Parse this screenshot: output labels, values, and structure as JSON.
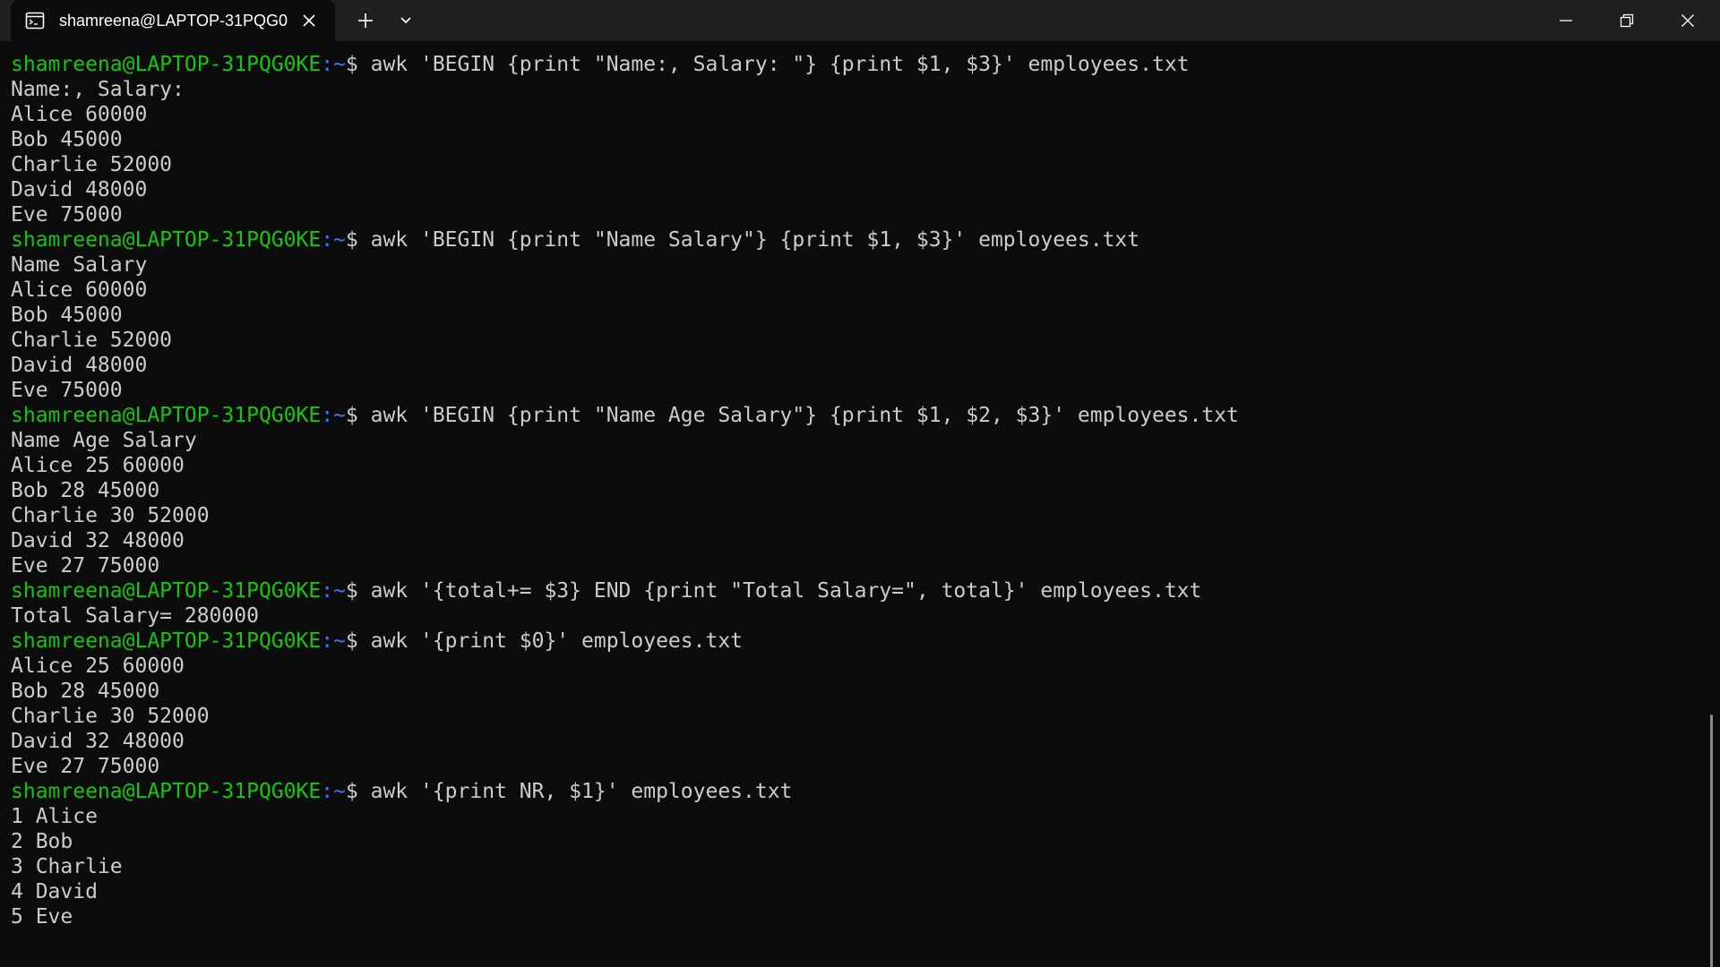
{
  "window": {
    "tab_title": "shamreena@LAPTOP-31PQG0",
    "tab_icon": "terminal-icon",
    "controls": {
      "close_tab_icon": "close-icon",
      "new_tab_icon": "plus-icon",
      "dropdown_icon": "chevron-down-icon",
      "minimize_icon": "minimize-icon",
      "maximize_icon": "restore-icon",
      "close_icon": "close-icon"
    }
  },
  "colors": {
    "background": "#0c0c0c",
    "titlebar": "#202020",
    "text": "#cccccc",
    "prompt_user": "#16c60c",
    "prompt_path": "#3b78ff"
  },
  "terminal": {
    "lines": [
      {
        "type": "prompt",
        "user": "shamreena@LAPTOP-31PQG0KE",
        "path": ":~",
        "sign": "$ ",
        "command": "awk 'BEGIN {print \"Name:, Salary: \"} {print $1, $3}' employees.txt"
      },
      {
        "type": "output",
        "text": "Name:, Salary:"
      },
      {
        "type": "output",
        "text": "Alice 60000"
      },
      {
        "type": "output",
        "text": "Bob 45000"
      },
      {
        "type": "output",
        "text": "Charlie 52000"
      },
      {
        "type": "output",
        "text": "David 48000"
      },
      {
        "type": "output",
        "text": "Eve 75000"
      },
      {
        "type": "prompt",
        "user": "shamreena@LAPTOP-31PQG0KE",
        "path": ":~",
        "sign": "$ ",
        "command": "awk 'BEGIN {print \"Name Salary\"} {print $1, $3}' employees.txt"
      },
      {
        "type": "output",
        "text": "Name Salary"
      },
      {
        "type": "output",
        "text": "Alice 60000"
      },
      {
        "type": "output",
        "text": "Bob 45000"
      },
      {
        "type": "output",
        "text": "Charlie 52000"
      },
      {
        "type": "output",
        "text": "David 48000"
      },
      {
        "type": "output",
        "text": "Eve 75000"
      },
      {
        "type": "prompt",
        "user": "shamreena@LAPTOP-31PQG0KE",
        "path": ":~",
        "sign": "$ ",
        "command": "awk 'BEGIN {print \"Name Age Salary\"} {print $1, $2, $3}' employees.txt"
      },
      {
        "type": "output",
        "text": "Name Age Salary"
      },
      {
        "type": "output",
        "text": "Alice 25 60000"
      },
      {
        "type": "output",
        "text": "Bob 28 45000"
      },
      {
        "type": "output",
        "text": "Charlie 30 52000"
      },
      {
        "type": "output",
        "text": "David 32 48000"
      },
      {
        "type": "output",
        "text": "Eve 27 75000"
      },
      {
        "type": "prompt",
        "user": "shamreena@LAPTOP-31PQG0KE",
        "path": ":~",
        "sign": "$ ",
        "command": "awk '{total+= $3} END {print \"Total Salary=\", total}' employees.txt"
      },
      {
        "type": "output",
        "text": "Total Salary= 280000"
      },
      {
        "type": "prompt",
        "user": "shamreena@LAPTOP-31PQG0KE",
        "path": ":~",
        "sign": "$ ",
        "command": "awk '{print $0}' employees.txt"
      },
      {
        "type": "output",
        "text": "Alice 25 60000"
      },
      {
        "type": "output",
        "text": "Bob 28 45000"
      },
      {
        "type": "output",
        "text": "Charlie 30 52000"
      },
      {
        "type": "output",
        "text": "David 32 48000"
      },
      {
        "type": "output",
        "text": "Eve 27 75000"
      },
      {
        "type": "prompt",
        "user": "shamreena@LAPTOP-31PQG0KE",
        "path": ":~",
        "sign": "$ ",
        "command": "awk '{print NR, $1}' employees.txt"
      },
      {
        "type": "output",
        "text": "1 Alice"
      },
      {
        "type": "output",
        "text": "2 Bob"
      },
      {
        "type": "output",
        "text": "3 Charlie"
      },
      {
        "type": "output",
        "text": "4 David"
      },
      {
        "type": "output",
        "text": "5 Eve"
      }
    ]
  }
}
